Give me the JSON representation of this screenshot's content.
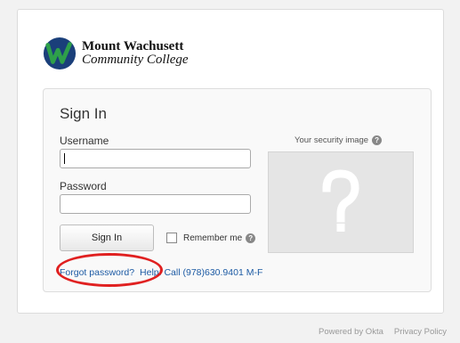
{
  "brand": {
    "name_line1": "Mount Wachusett",
    "name_line2": "Community College"
  },
  "signin": {
    "title": "Sign In",
    "username_label": "Username",
    "username_value": "",
    "password_label": "Password",
    "password_value": "",
    "button_label": "Sign In",
    "remember_label": "Remember me",
    "remember_checked": false,
    "security_image_label": "Your security image",
    "help_glyph": "?"
  },
  "links": {
    "forgot": "Forgot password?",
    "help": "Help: Call (978)630.9401 M-F"
  },
  "footer": {
    "powered": "Powered by Okta",
    "privacy": "Privacy Policy"
  },
  "icons": [
    "college-logo-icon",
    "help-icon",
    "question-mark-icon"
  ],
  "colors": {
    "link": "#1d5ba4",
    "highlight": "#e02020",
    "logo_blue": "#1a3f7a",
    "logo_green": "#2ea04a"
  }
}
